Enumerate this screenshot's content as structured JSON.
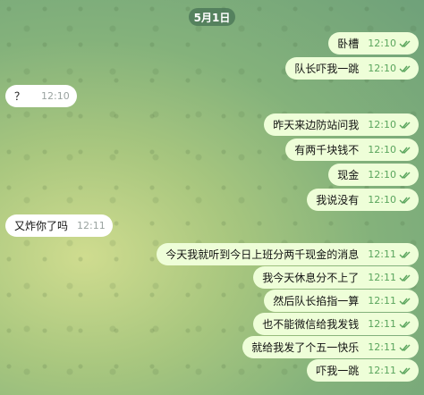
{
  "date_label": "5月1日",
  "messages": [
    {
      "text": "卧槽",
      "time": "12:10"
    },
    {
      "text": "队长吓我一跳",
      "time": "12:10"
    },
    {
      "text": "？",
      "time": "12:10"
    },
    {
      "text": "昨天来边防站问我",
      "time": "12:10"
    },
    {
      "text": "有两千块钱不",
      "time": "12:10"
    },
    {
      "text": "现金",
      "time": "12:10"
    },
    {
      "text": "我说没有",
      "time": "12:10"
    },
    {
      "text": "又炸你了吗",
      "time": "12:11"
    },
    {
      "text": "今天我就听到今日上班分两千现金的消息",
      "time": "12:11"
    },
    {
      "text": "我今天休息分不上了",
      "time": "12:11"
    },
    {
      "text": "然后队长掐指一算",
      "time": "12:11"
    },
    {
      "text": "也不能微信给我发钱",
      "time": "12:11"
    },
    {
      "text": "就给我发了个五一快乐",
      "time": "12:11"
    },
    {
      "text": "吓我一跳",
      "time": "12:11"
    }
  ]
}
